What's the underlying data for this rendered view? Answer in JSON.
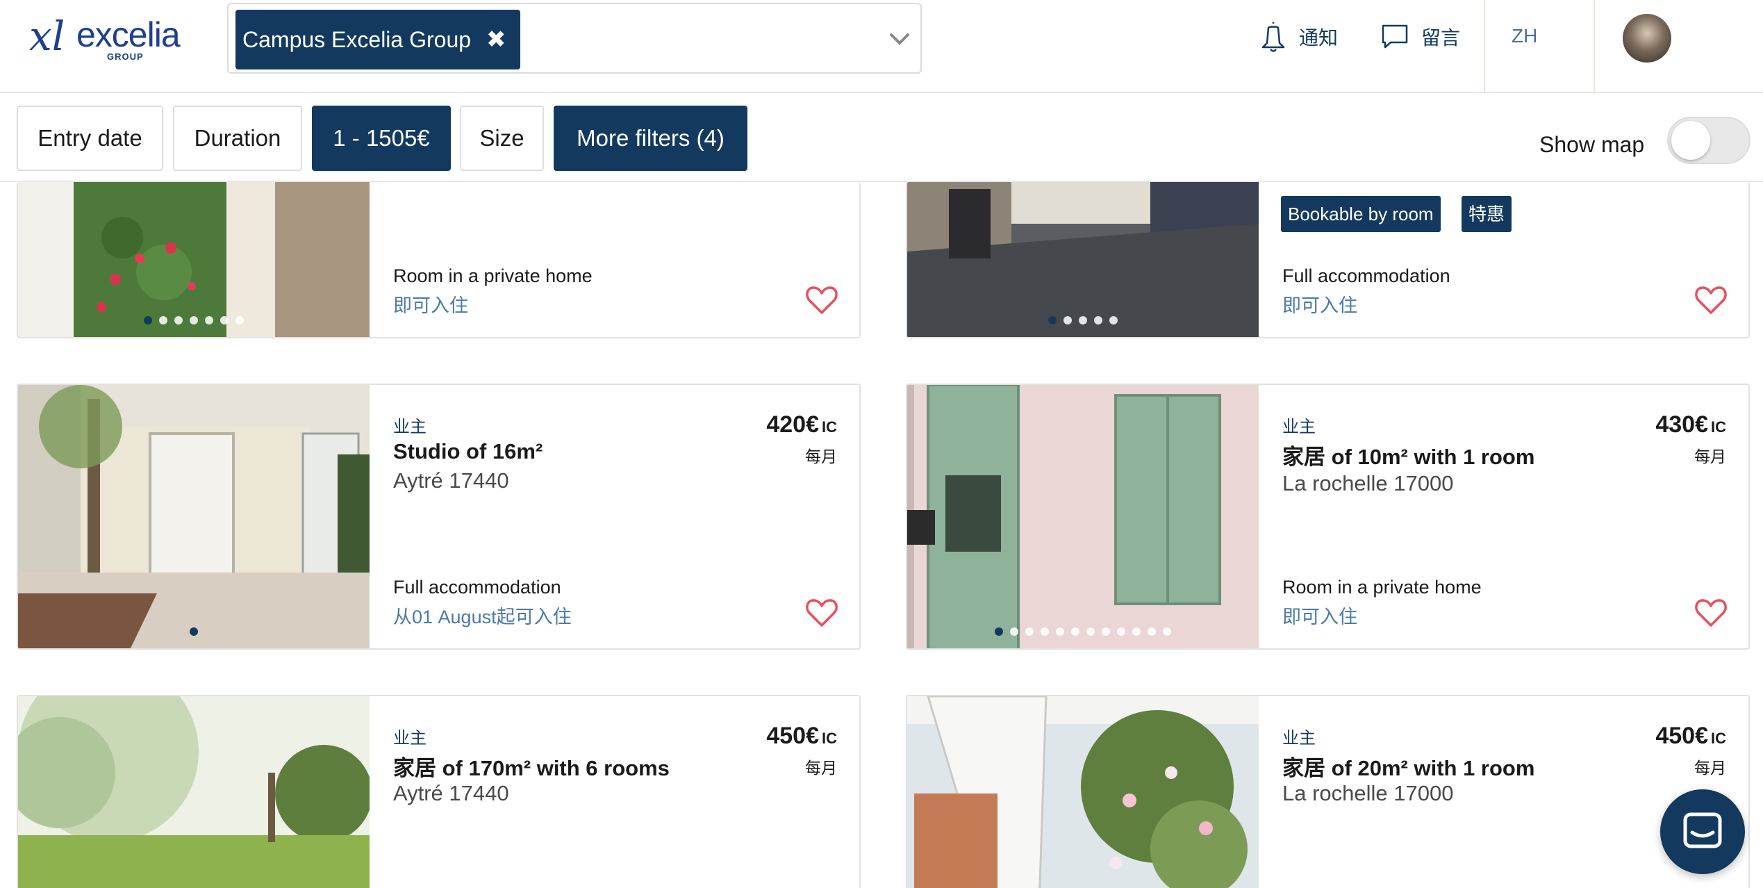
{
  "header": {
    "logo": {
      "brand": "excelia",
      "sub": "GROUP"
    },
    "campus_tag": "Campus Excelia Group",
    "nav": {
      "notifications": "通知",
      "messages": "留言",
      "language": "ZH"
    }
  },
  "filters": {
    "entry_date": "Entry date",
    "duration": "Duration",
    "price_range": "1 - 1505€",
    "size": "Size",
    "more_filters": "More filters (4)",
    "show_map": "Show map",
    "show_map_enabled": false
  },
  "listings": [
    {
      "type": "Room in a private home",
      "availability": "即可入住",
      "photo_count": 7,
      "photo_index": 0
    },
    {
      "badges": [
        "Bookable by room",
        "特惠"
      ],
      "type": "Full accommodation",
      "availability": "即可入住",
      "photo_count": 5,
      "photo_index": 0
    },
    {
      "owner": "业主",
      "title": "Studio of 16m²",
      "city": "Aytré 17440",
      "price": "420€",
      "price_suffix": "IC",
      "period": "每月",
      "type": "Full accommodation",
      "availability": "从01 August起可入住",
      "photo_count": 1,
      "photo_index": 0
    },
    {
      "owner": "业主",
      "title": "家居 of 10m² with 1 room",
      "city": "La rochelle 17000",
      "price": "430€",
      "price_suffix": "IC",
      "period": "每月",
      "type": "Room in a private home",
      "availability": "即可入住",
      "photo_count": 12,
      "photo_index": 0
    },
    {
      "owner": "业主",
      "title": "家居 of 170m² with 6 rooms",
      "city": "Aytré 17440",
      "price": "450€",
      "price_suffix": "IC",
      "period": "每月"
    },
    {
      "owner": "业主",
      "title": "家居 of 20m² with 1 room",
      "city": "La rochelle 17000",
      "price": "450€",
      "price_suffix": "IC",
      "period": "每月"
    }
  ],
  "icons": {
    "notifications": "bell-icon",
    "messages": "chat-bubble-icon",
    "favorite": "heart-icon",
    "chat_widget": "messenger-icon"
  },
  "colors": {
    "primary": "#133a5e",
    "heart": "#e94e5c",
    "availability": "#4a7aa8"
  }
}
